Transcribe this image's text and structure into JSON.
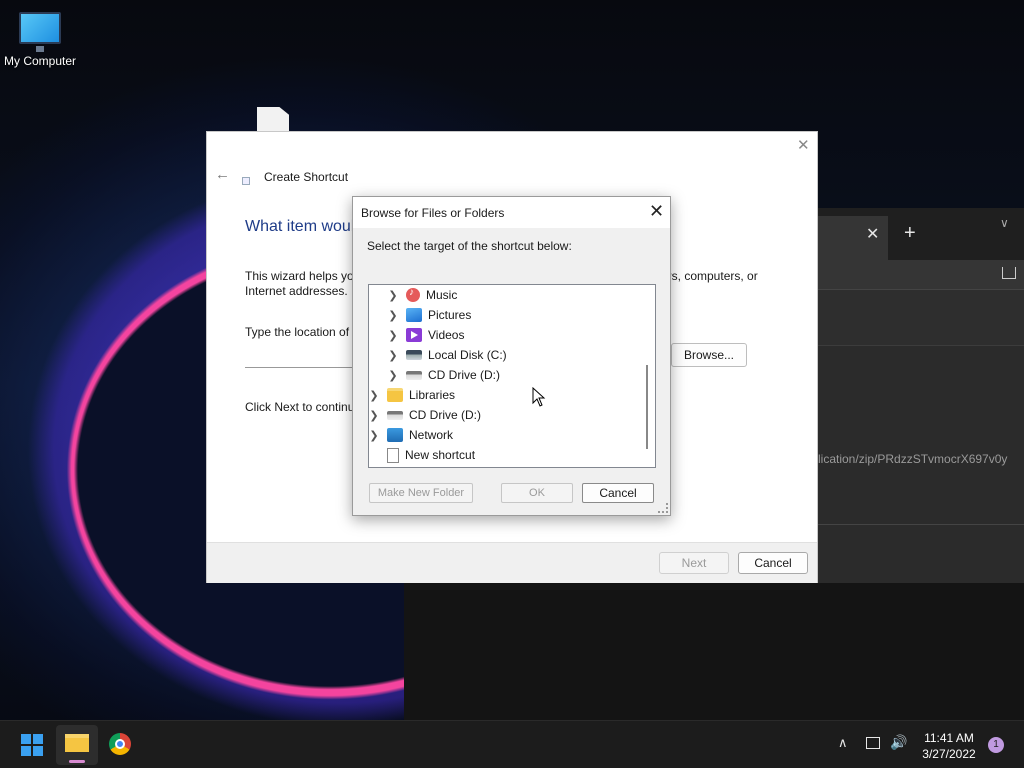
{
  "desktop": {
    "icons": [
      {
        "label": "My Computer",
        "icon": "monitor-icon"
      }
    ]
  },
  "browser": {
    "url_text": "lication/zip/PRdzzSTvmocrX697v0y"
  },
  "wizard": {
    "title": "Create Shortcut",
    "heading": "What item woul",
    "intro": "This wizard helps you",
    "intro_line2": "Internet addresses.",
    "intro_tail": "ers, computers, or",
    "location_label": "Type the location of t",
    "browse_button": "Browse...",
    "next_instruction": "Click Next to continu",
    "next_button": "Next",
    "cancel_button": "Cancel"
  },
  "browse_dialog": {
    "title": "Browse for Files or Folders",
    "prompt": "Select the target of the shortcut below:",
    "tree": [
      {
        "label": "Music",
        "icon": "music-icon",
        "level": 1,
        "expandable": true
      },
      {
        "label": "Pictures",
        "icon": "pictures-icon",
        "level": 1,
        "expandable": true
      },
      {
        "label": "Videos",
        "icon": "videos-icon",
        "level": 1,
        "expandable": true
      },
      {
        "label": "Local Disk (C:)",
        "icon": "disk-icon",
        "level": 1,
        "expandable": true
      },
      {
        "label": "CD Drive (D:)",
        "icon": "cd-drive-icon",
        "level": 1,
        "expandable": true
      },
      {
        "label": "Libraries",
        "icon": "folder-icon",
        "level": 0,
        "expandable": true
      },
      {
        "label": "CD Drive (D:)",
        "icon": "cd-drive-icon",
        "level": 0,
        "expandable": true
      },
      {
        "label": "Network",
        "icon": "network-icon",
        "level": 0,
        "expandable": true
      },
      {
        "label": "New shortcut",
        "icon": "shortcut-icon",
        "level": 0,
        "expandable": false
      }
    ],
    "make_new_folder_button": "Make New Folder",
    "ok_button": "OK",
    "cancel_button": "Cancel"
  },
  "taskbar": {
    "time": "11:41 AM",
    "date": "3/27/2022",
    "notification_count": "1"
  },
  "colors": {
    "wizard_heading": "#1f3c88",
    "start_blue": "#3aa0f0",
    "taskbar_bg": "#1c1c1c"
  }
}
